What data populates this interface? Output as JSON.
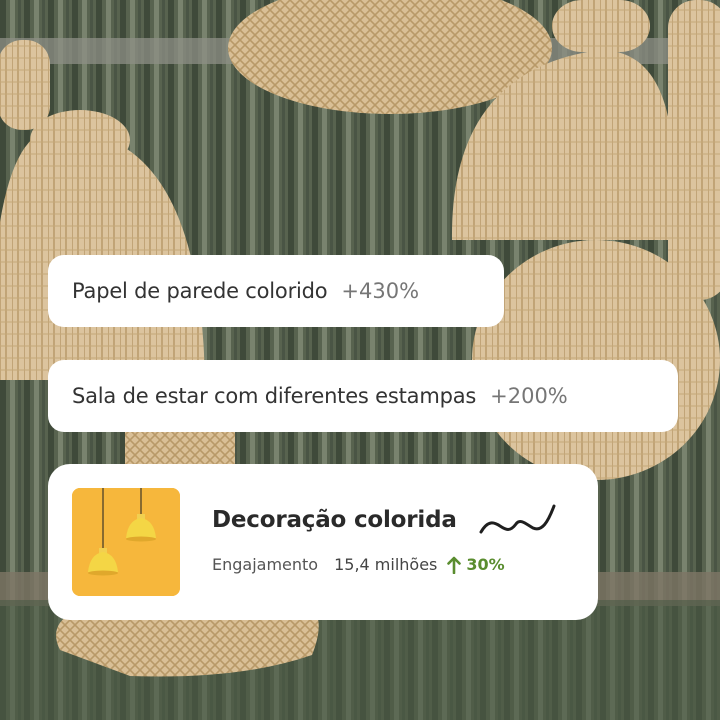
{
  "trends": [
    {
      "label": "Papel de parede colorido",
      "change": "+430%"
    },
    {
      "label": "Sala de estar com diferentes estampas",
      "change": "+200%"
    }
  ],
  "featured": {
    "title": "Decoração colorida",
    "engagement_label": "Engajamento",
    "engagement_value": "15,4 milhões",
    "growth": "30%",
    "thumbnail_icon": "pendant-lamps-image",
    "trend_icon": "sparkline-icon",
    "growth_icon": "arrow-up-icon"
  },
  "colors": {
    "growth": "#5a8d2f",
    "thumbnail_bg": "#f6b73c"
  }
}
